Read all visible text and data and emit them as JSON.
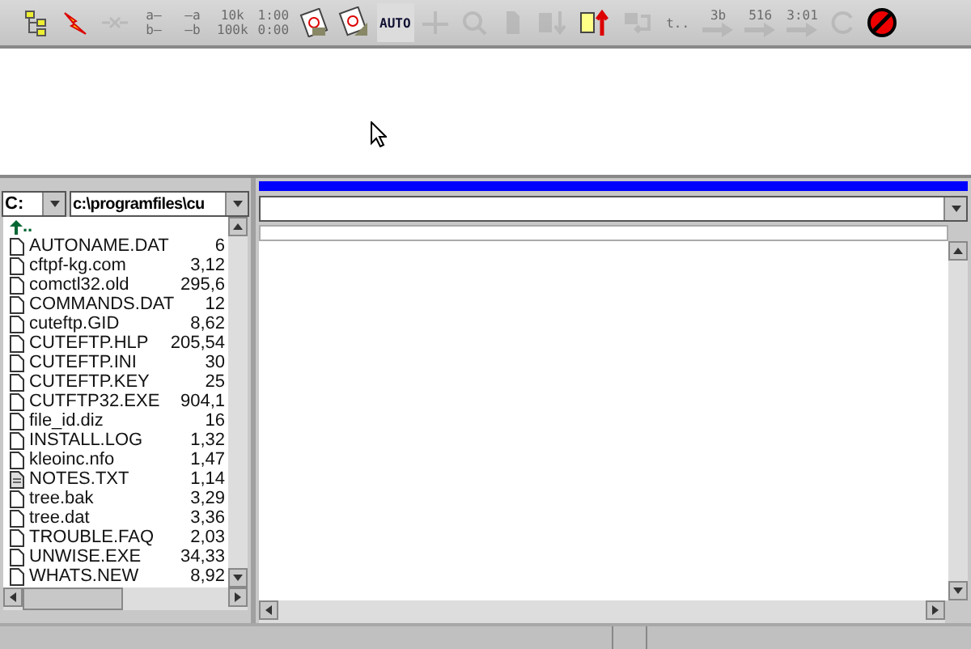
{
  "toolbar": [
    {
      "kind": "icon",
      "disabled": false
    },
    {
      "kind": "icon",
      "disabled": false
    },
    {
      "kind": "icon",
      "disabled": true
    },
    {
      "kind": "text",
      "lines": [
        "a—",
        "b—"
      ],
      "disabled": true
    },
    {
      "kind": "text",
      "lines": [
        "—a",
        "—b"
      ],
      "disabled": true
    },
    {
      "kind": "text",
      "lines": [
        "10k",
        "100k"
      ],
      "disabled": true
    },
    {
      "kind": "text",
      "lines": [
        "1:00",
        "0:00"
      ],
      "disabled": true
    },
    {
      "kind": "icon",
      "disabled": false
    },
    {
      "kind": "icon",
      "disabled": false
    },
    {
      "kind": "auto",
      "label": "AUTO",
      "disabled": false
    },
    {
      "kind": "icon",
      "disabled": true
    },
    {
      "kind": "icon",
      "disabled": true
    },
    {
      "kind": "icon",
      "disabled": true
    },
    {
      "kind": "icon",
      "disabled": true
    },
    {
      "kind": "icon",
      "disabled": false
    },
    {
      "kind": "icon",
      "disabled": true
    },
    {
      "kind": "text",
      "lines": [
        "t.."
      ],
      "disabled": true
    },
    {
      "kind": "arrow",
      "label": "3b",
      "disabled": true
    },
    {
      "kind": "arrow",
      "label": "516",
      "disabled": true
    },
    {
      "kind": "arrow",
      "label": "3:01",
      "disabled": true
    },
    {
      "kind": "icon",
      "disabled": true
    },
    {
      "kind": "icon",
      "disabled": false
    }
  ],
  "local": {
    "drive": "C:",
    "path": "c:\\programfiles\\cu",
    "up_label": "..",
    "files": [
      {
        "name": "AUTONAME.DAT",
        "size": "6",
        "kind": "file"
      },
      {
        "name": "cftpf-kg.com",
        "size": "3,12",
        "kind": "file"
      },
      {
        "name": "comctl32.old",
        "size": "295,6",
        "kind": "file"
      },
      {
        "name": "COMMANDS.DAT",
        "size": "12",
        "kind": "file"
      },
      {
        "name": "cuteftp.GID",
        "size": "8,62",
        "kind": "file"
      },
      {
        "name": "CUTEFTP.HLP",
        "size": "205,54",
        "kind": "file"
      },
      {
        "name": "CUTEFTP.INI",
        "size": "30",
        "kind": "file"
      },
      {
        "name": "CUTEFTP.KEY",
        "size": "25",
        "kind": "file"
      },
      {
        "name": "CUTFTP32.EXE",
        "size": "904,1",
        "kind": "file"
      },
      {
        "name": "file_id.diz",
        "size": "16",
        "kind": "file"
      },
      {
        "name": "INSTALL.LOG",
        "size": "1,32",
        "kind": "file"
      },
      {
        "name": "kleoinc.nfo",
        "size": "1,47",
        "kind": "file"
      },
      {
        "name": "NOTES.TXT",
        "size": "1,14",
        "kind": "text"
      },
      {
        "name": "tree.bak",
        "size": "3,29",
        "kind": "file"
      },
      {
        "name": "tree.dat",
        "size": "3,36",
        "kind": "file"
      },
      {
        "name": "TROUBLE.FAQ",
        "size": "2,03",
        "kind": "file"
      },
      {
        "name": "UNWISE.EXE",
        "size": "34,33",
        "kind": "file"
      },
      {
        "name": "WHATS.NEW",
        "size": "8,92",
        "kind": "file"
      }
    ]
  },
  "remote": {
    "connected": true
  }
}
